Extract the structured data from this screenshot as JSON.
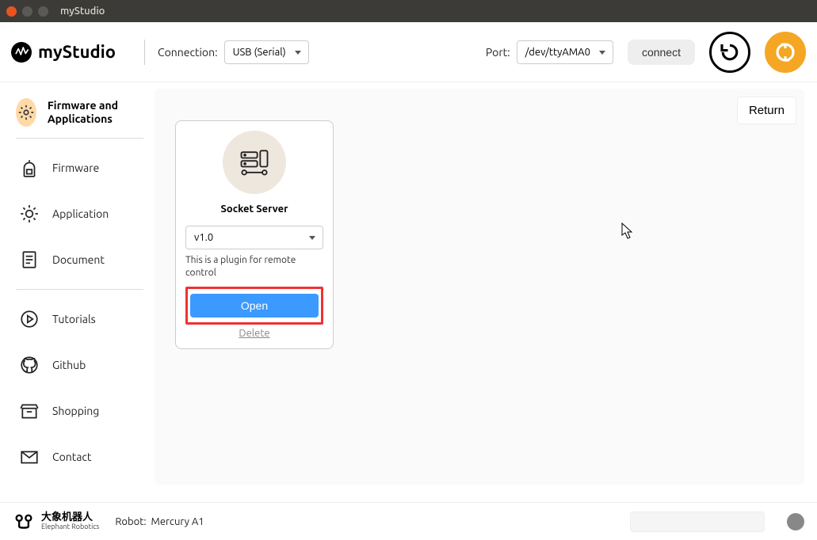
{
  "window": {
    "title": "myStudio"
  },
  "logo": {
    "text": "myStudio"
  },
  "toolbar": {
    "connection_label": "Connection:",
    "connection_value": "USB (Serial)",
    "port_label": "Port:",
    "port_value": "/dev/ttyAMA0",
    "connect_label": "connect"
  },
  "sidebar": {
    "header": "Firmware and Applications",
    "items": [
      {
        "label": "Firmware"
      },
      {
        "label": "Application"
      },
      {
        "label": "Document"
      },
      {
        "label": "Tutorials"
      },
      {
        "label": "Github"
      },
      {
        "label": "Shopping"
      },
      {
        "label": "Contact"
      }
    ]
  },
  "content": {
    "return_label": "Return",
    "card": {
      "title": "Socket Server",
      "version": "v1.0",
      "description": "This is a plugin for remote control",
      "open_label": "Open",
      "delete_label": "Delete"
    }
  },
  "footer": {
    "brand_cn": "大象机器人",
    "brand_en": "Elephant Robotics",
    "robot_label": "Robot:",
    "robot_value": "Mercury A1"
  }
}
